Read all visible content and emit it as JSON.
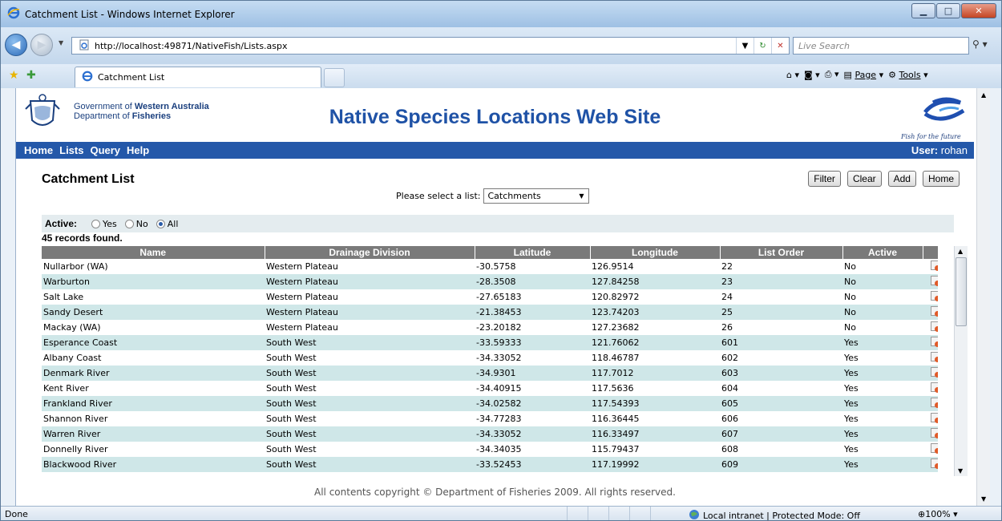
{
  "window": {
    "title": "Catchment List - Windows Internet Explorer"
  },
  "browser": {
    "url": "http://localhost:49871/NativeFish/Lists.aspx",
    "search_placeholder": "Live Search",
    "tab_title": "Catchment List",
    "cmd": {
      "page": "Page",
      "tools": "Tools"
    }
  },
  "header": {
    "gov_line1_a": "Government of",
    "gov_line1_b": "Western Australia",
    "gov_line2_a": "Department of",
    "gov_line2_b": "Fisheries",
    "site_title": "Native Species Locations Web Site",
    "tagline": "Fish for the future"
  },
  "menu": {
    "items": [
      "Home",
      "Lists",
      "Query",
      "Help"
    ],
    "user_label": "User:",
    "user_name": "rohan"
  },
  "page": {
    "title": "Catchment List",
    "buttons": [
      "Filter",
      "Clear",
      "Add",
      "Home"
    ],
    "select_label": "Please select a list:",
    "select_value": "Catchments",
    "active_label": "Active:",
    "radio": [
      {
        "label": "Yes",
        "checked": false
      },
      {
        "label": "No",
        "checked": false
      },
      {
        "label": "All",
        "checked": true
      }
    ],
    "records_found": "45 records found."
  },
  "grid": {
    "columns": [
      "Name",
      "Drainage Division",
      "Latitude",
      "Longitude",
      "List Order",
      "Active"
    ],
    "rows": [
      [
        "Nullarbor (WA)",
        "Western Plateau",
        "-30.5758",
        "126.9514",
        "22",
        "No"
      ],
      [
        "Warburton",
        "Western Plateau",
        "-28.3508",
        "127.84258",
        "23",
        "No"
      ],
      [
        "Salt Lake",
        "Western Plateau",
        "-27.65183",
        "120.82972",
        "24",
        "No"
      ],
      [
        "Sandy Desert",
        "Western Plateau",
        "-21.38453",
        "123.74203",
        "25",
        "No"
      ],
      [
        "Mackay (WA)",
        "Western Plateau",
        "-23.20182",
        "127.23682",
        "26",
        "No"
      ],
      [
        "Esperance Coast",
        "South West",
        "-33.59333",
        "121.76062",
        "601",
        "Yes"
      ],
      [
        "Albany Coast",
        "South West",
        "-34.33052",
        "118.46787",
        "602",
        "Yes"
      ],
      [
        "Denmark River",
        "South West",
        "-34.9301",
        "117.7012",
        "603",
        "Yes"
      ],
      [
        "Kent River",
        "South West",
        "-34.40915",
        "117.5636",
        "604",
        "Yes"
      ],
      [
        "Frankland River",
        "South West",
        "-34.02582",
        "117.54393",
        "605",
        "Yes"
      ],
      [
        "Shannon River",
        "South West",
        "-34.77283",
        "116.36445",
        "606",
        "Yes"
      ],
      [
        "Warren River",
        "South West",
        "-34.33052",
        "116.33497",
        "607",
        "Yes"
      ],
      [
        "Donnelly River",
        "South West",
        "-34.34035",
        "115.79437",
        "608",
        "Yes"
      ],
      [
        "Blackwood River",
        "South West",
        "-33.52453",
        "117.19992",
        "609",
        "Yes"
      ]
    ]
  },
  "footer": {
    "text": "All contents copyright © Department of Fisheries 2009. All rights reserved."
  },
  "status": {
    "text": "Done",
    "zone": "Local intranet | Protected Mode: Off",
    "zoom": "100%"
  },
  "colors": {
    "brand_blue": "#2458a9",
    "row_alt": "#cfe7e8",
    "header_gray": "#7a7a7a"
  }
}
